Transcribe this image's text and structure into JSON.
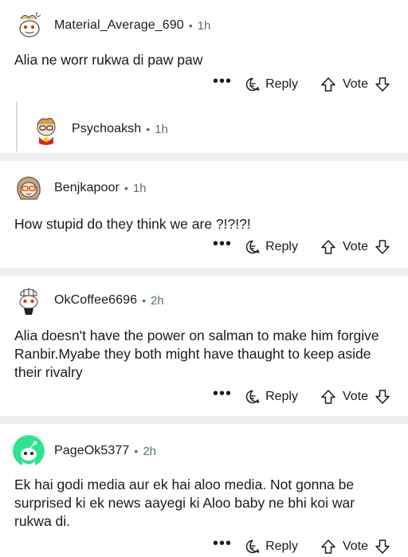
{
  "comments": [
    {
      "username": "Material_Average_690",
      "age": "1h",
      "text": "Alia ne worr rukwa di paw paw",
      "reply_label": "Reply",
      "vote_label": "Vote",
      "more_label": "•••"
    },
    {
      "username": "Psychoaksh",
      "age": "1h",
      "text": ""
    },
    {
      "username": "Benjkapoor",
      "age": "1h",
      "text": "How stupid do they think we are ?!?!?!",
      "reply_label": "Reply",
      "vote_label": "Vote",
      "more_label": "•••"
    },
    {
      "username": "OkCoffee6696",
      "age": "2h",
      "text": "Alia doesn't have the power on salman to make him forgive Ranbir.Myabe they both might have thaught to keep aside their rivalry",
      "reply_label": "Reply",
      "vote_label": "Vote",
      "more_label": "•••"
    },
    {
      "username": "PageOk5377",
      "age": "2h",
      "text": "Ek hai godi media aur ek hai aloo media. Not gonna be surprised ki ek news aayegi ki Aloo baby ne bhi koi war rukwa di.",
      "reply_label": "Reply",
      "vote_label": "Vote",
      "more_label": "•••"
    }
  ],
  "separator_dot": "•",
  "colors": {
    "separator": "#edeff1",
    "meta_text": "#576f76",
    "thread_line": "#d7dadc"
  }
}
